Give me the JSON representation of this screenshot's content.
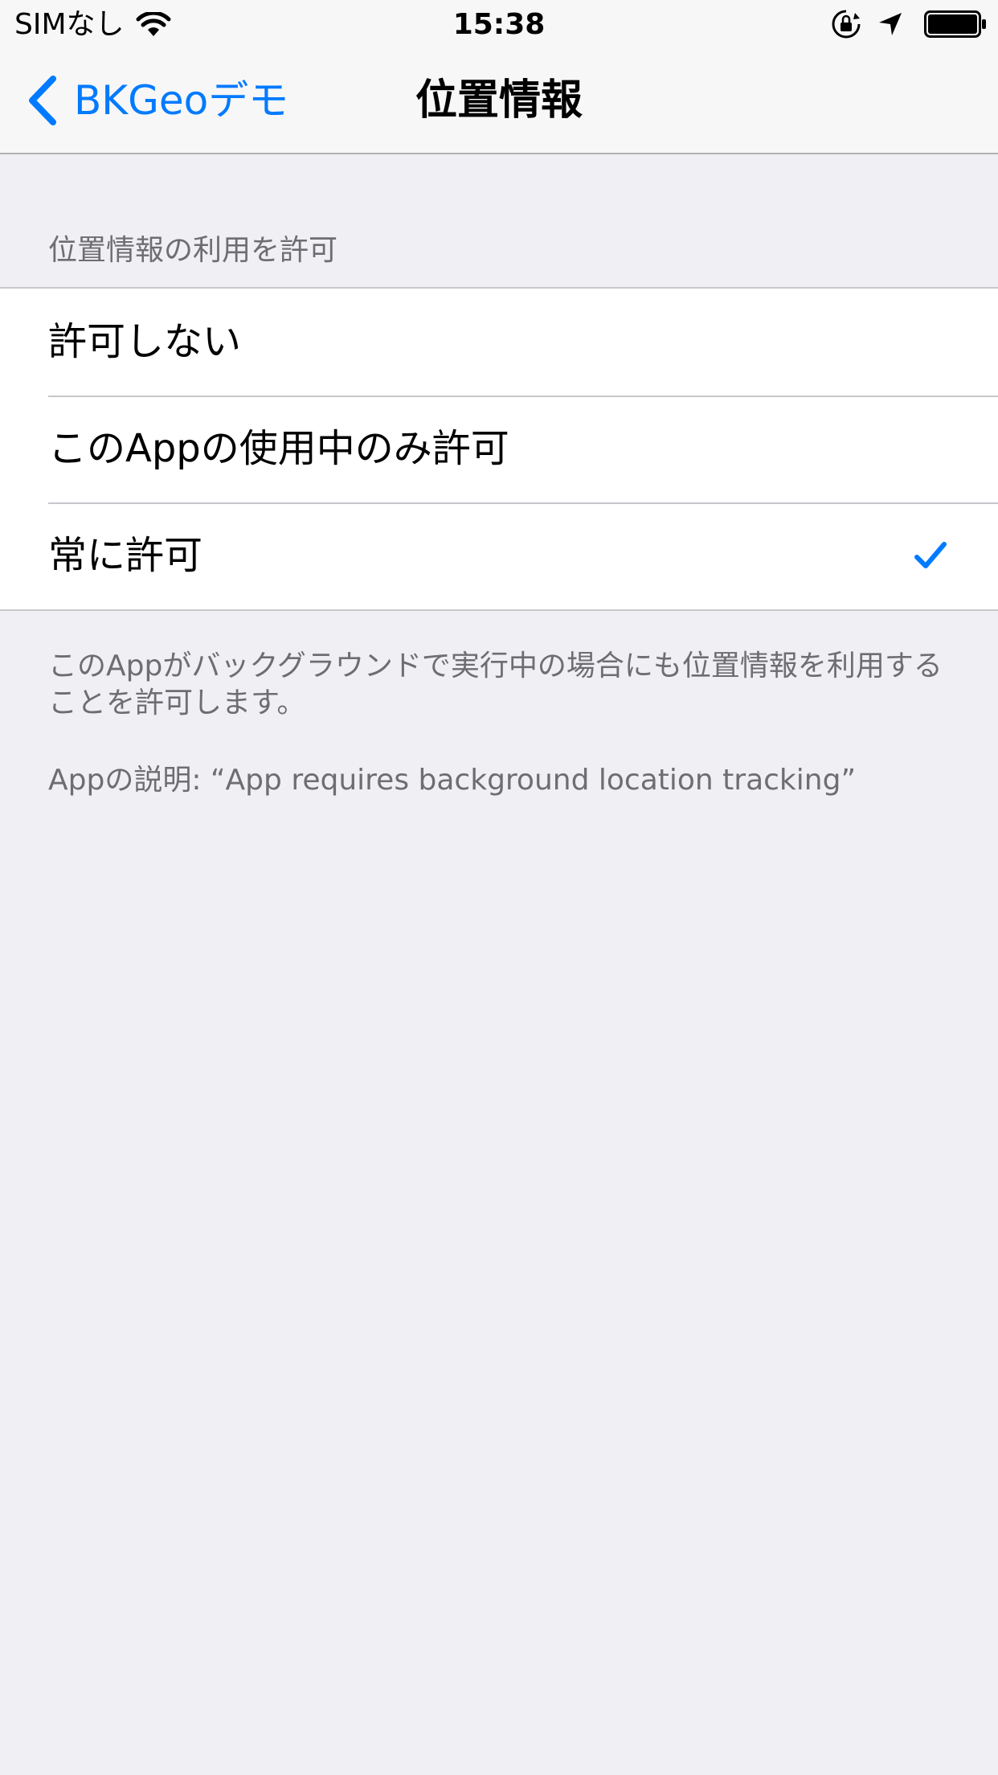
{
  "status_bar": {
    "carrier": "SIMなし",
    "time": "15:38",
    "icons": [
      "wifi-icon",
      "orientation-lock-icon",
      "location-arrow-icon",
      "battery-icon"
    ]
  },
  "nav": {
    "back_label": "BKGeoデモ",
    "title": "位置情報",
    "accent_color": "#007aff"
  },
  "section": {
    "header": "位置情報の利用を許可",
    "options": [
      {
        "label": "許可しない",
        "selected": false
      },
      {
        "label": "このAppの使用中のみ許可",
        "selected": false
      },
      {
        "label": "常に許可",
        "selected": true
      }
    ]
  },
  "footer": {
    "text": "このAppがバックグラウンドで実行中の場合にも位置情報を利用することを許可します。",
    "description": "Appの説明: “App requires background location tracking”"
  }
}
